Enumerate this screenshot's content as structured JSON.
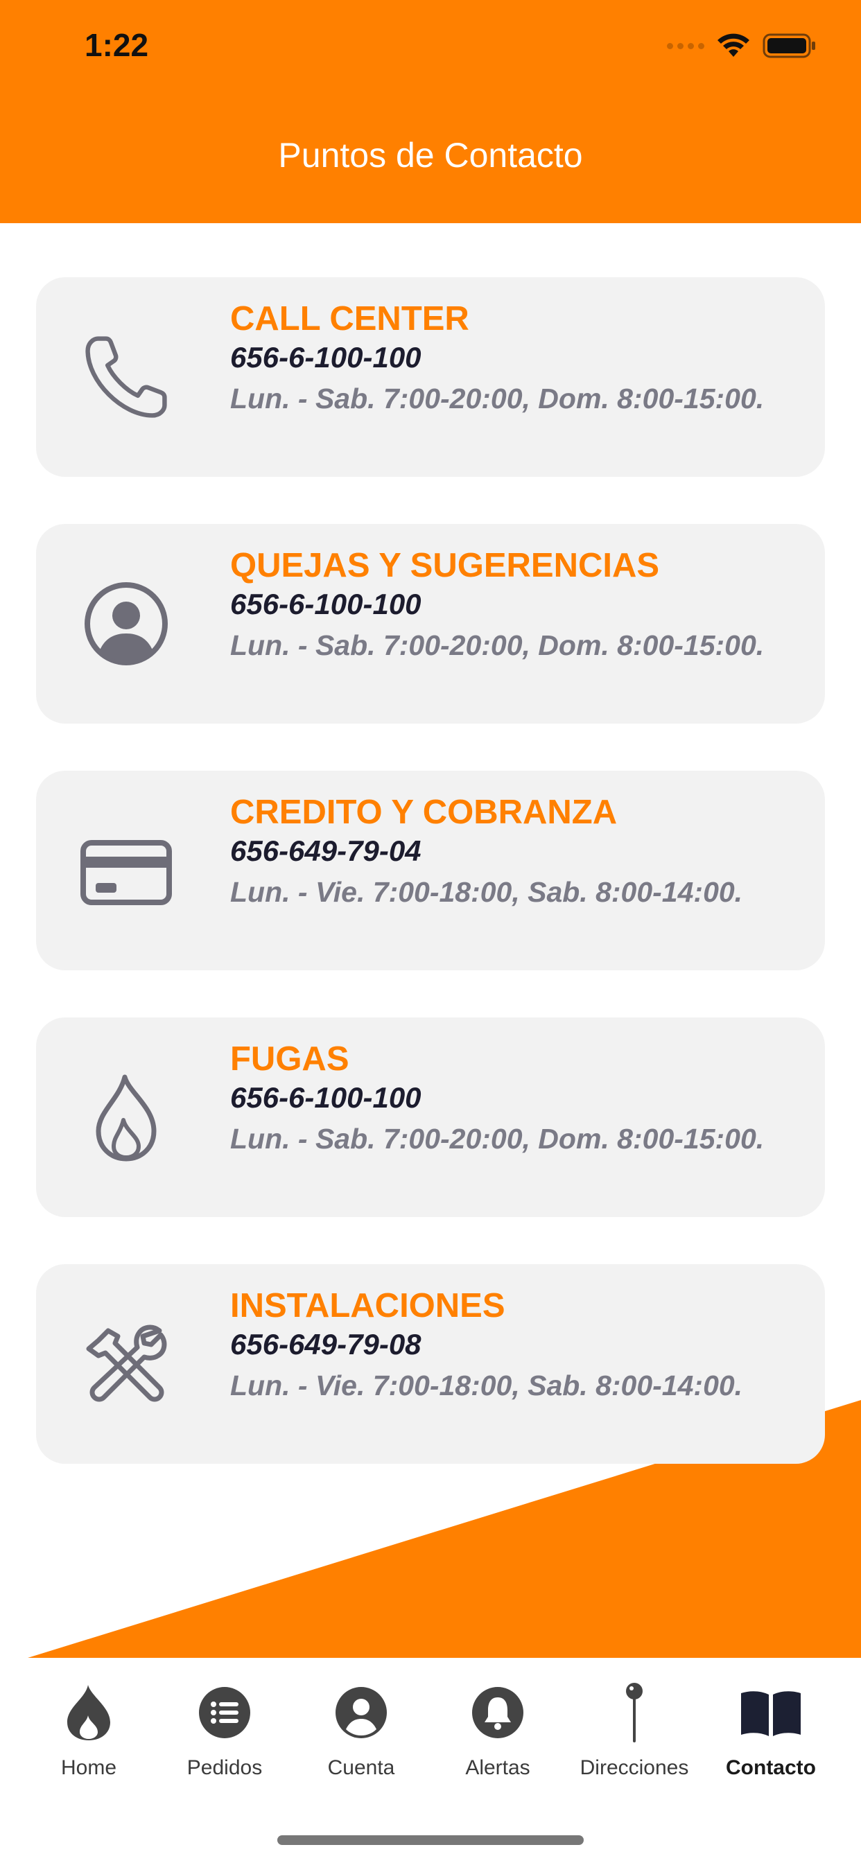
{
  "status_bar": {
    "time": "1:22"
  },
  "header": {
    "title": "Puntos de Contacto"
  },
  "colors": {
    "accent": "#FF8000",
    "card_bg": "#F2F2F2",
    "icon_gray": "#6E6D78",
    "phone_text": "#1C1C2E",
    "hours_text": "#7A7A86",
    "tab_icon": "#444444"
  },
  "contacts": [
    {
      "title": "CALL CENTER",
      "phone": "656-6-100-100",
      "hours": "Lun. - Sab. 7:00-20:00, Dom. 8:00-15:00.",
      "icon": "phone-icon"
    },
    {
      "title": "QUEJAS Y SUGERENCIAS",
      "phone": "656-6-100-100",
      "hours": "Lun. - Sab. 7:00-20:00, Dom. 8:00-15:00.",
      "icon": "user-circle-icon"
    },
    {
      "title": "CREDITO Y COBRANZA",
      "phone": "656-649-79-04",
      "hours": "Lun. - Vie. 7:00-18:00, Sab. 8:00-14:00.",
      "icon": "credit-card-icon"
    },
    {
      "title": "FUGAS",
      "phone": "656-6-100-100",
      "hours": "Lun. - Sab. 7:00-20:00, Dom. 8:00-15:00.",
      "icon": "flame-icon"
    },
    {
      "title": "INSTALACIONES",
      "phone": "656-649-79-08",
      "hours": "Lun. - Vie. 7:00-18:00, Sab. 8:00-14:00.",
      "icon": "tools-icon"
    }
  ],
  "tabs": [
    {
      "label": "Home",
      "icon": "flame-icon",
      "active": false
    },
    {
      "label": "Pedidos",
      "icon": "list-icon",
      "active": false
    },
    {
      "label": "Cuenta",
      "icon": "user-icon",
      "active": false
    },
    {
      "label": "Alertas",
      "icon": "bell-icon",
      "active": false
    },
    {
      "label": "Direcciones",
      "icon": "pin-icon",
      "active": false
    },
    {
      "label": "Contacto",
      "icon": "book-icon",
      "active": true
    }
  ]
}
